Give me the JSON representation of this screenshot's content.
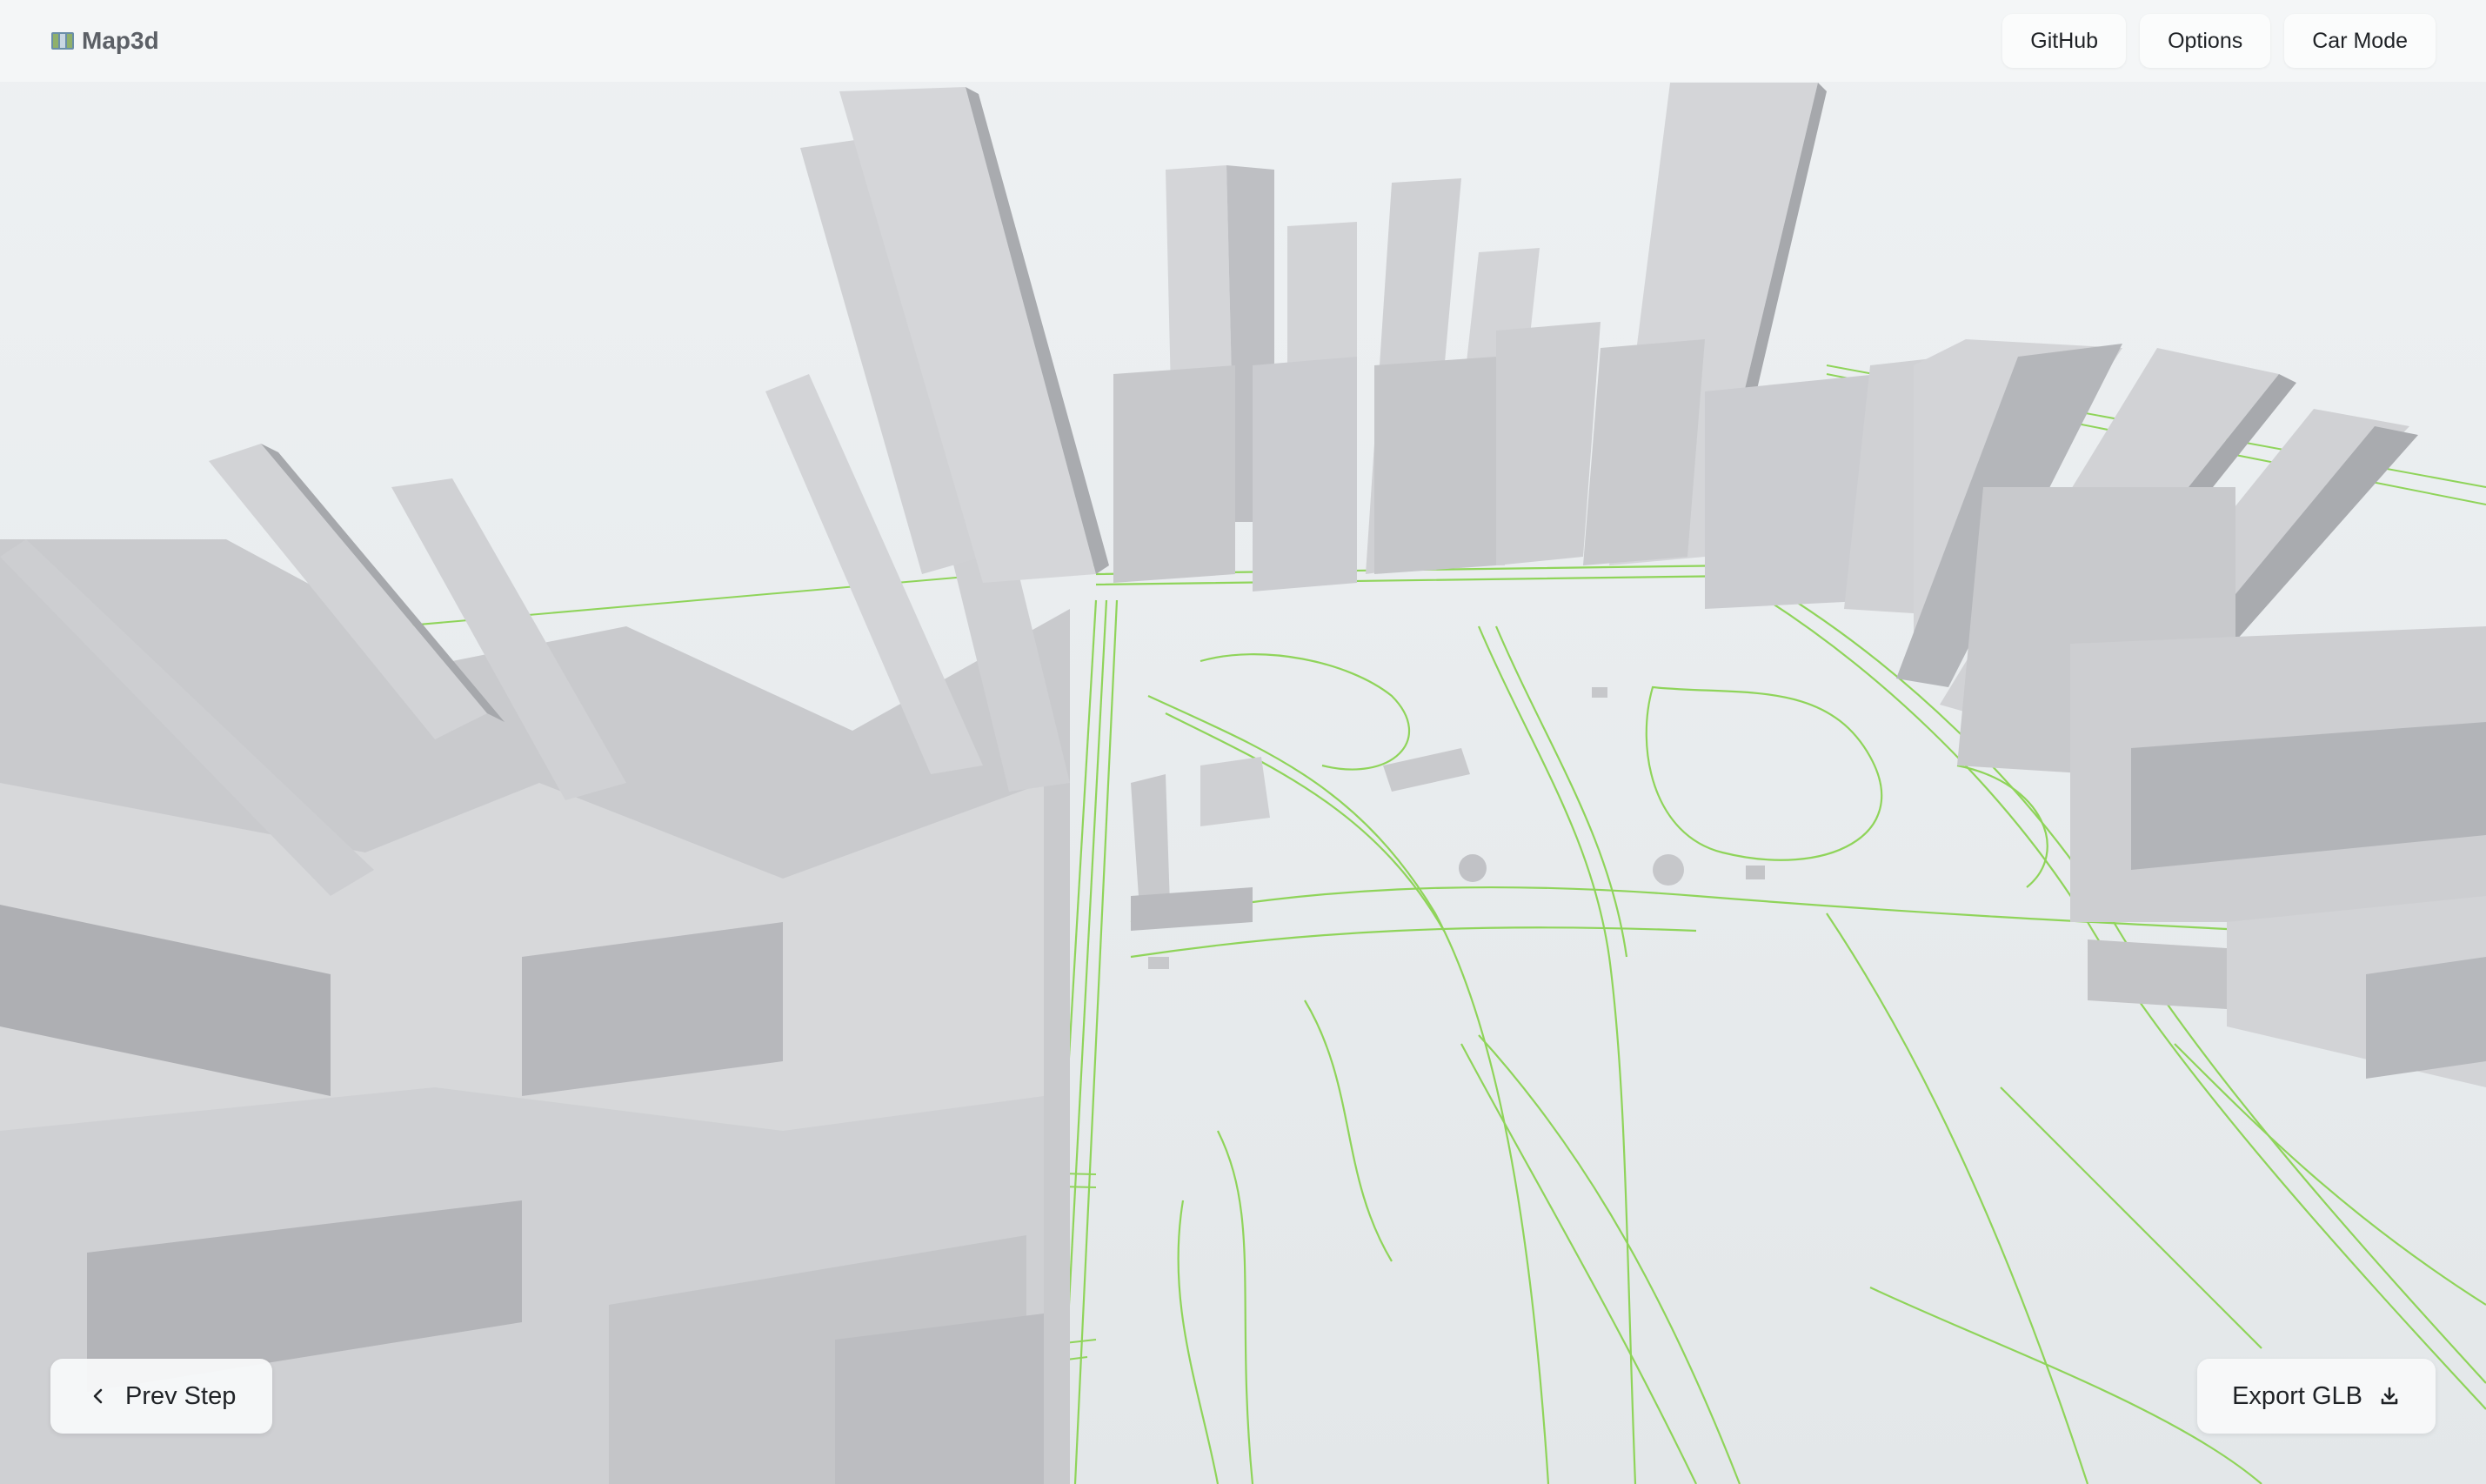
{
  "app": {
    "name": "Map3d",
    "logo_icon": "map-icon"
  },
  "nav": {
    "github": "GitHub",
    "options": "Options",
    "car_mode": "Car Mode"
  },
  "controls": {
    "prev_step": "Prev Step",
    "prev_icon": "chevron-left-icon",
    "export": "Export GLB",
    "export_icon": "download-icon"
  },
  "colors": {
    "road": "#8fd45a",
    "building_light": "#d6d7d9",
    "building_dark": "#a8aaae",
    "ground": "#e8ebed"
  }
}
